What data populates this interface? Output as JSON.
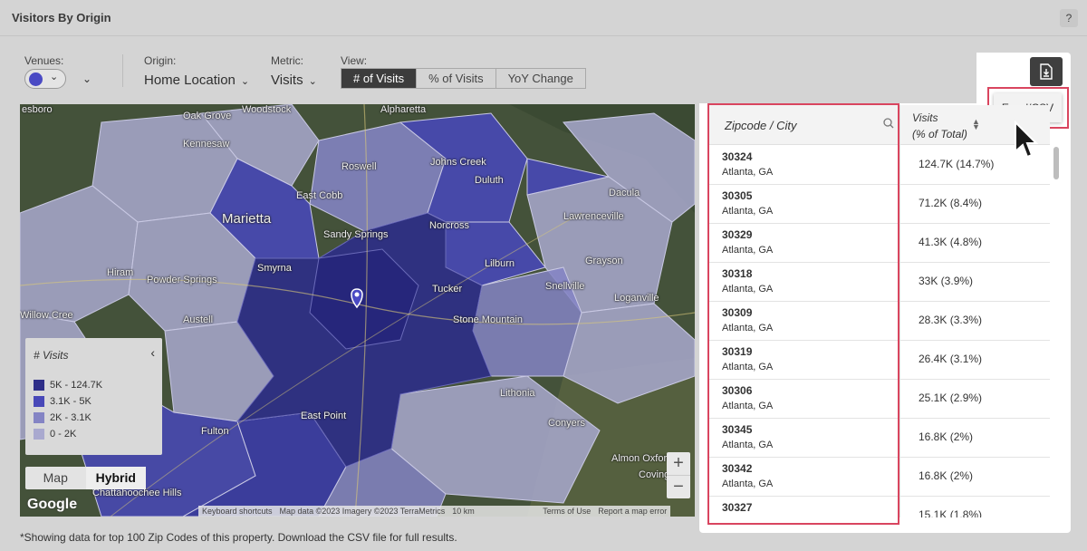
{
  "header": {
    "title": "Visitors By Origin",
    "help": "?"
  },
  "controls": {
    "venues_label": "Venues:",
    "origin_label": "Origin:",
    "origin_value": "Home Location",
    "metric_label": "Metric:",
    "metric_value": "Visits",
    "view_label": "View:",
    "view_options": [
      "# of Visits",
      "% of Visits",
      "YoY Change"
    ],
    "view_selected": "# of Visits",
    "venue_color": "#4a4ac4"
  },
  "map": {
    "labels": [
      "esboro",
      "Oak Grove",
      "Woodstock",
      "Alpharetta",
      "Kennesaw",
      "Roswell",
      "Johns Creek",
      "Duluth",
      "East Cobb",
      "Marietta",
      "Sandy Springs",
      "Norcross",
      "Dacula",
      "Lawrenceville",
      "Hiram",
      "Powder Springs",
      "Smyrna",
      "Grayson",
      "Snellville",
      "Tucker",
      "Lilburn",
      "Loganville",
      "Willow Cree",
      "Austell",
      "Stone Mountain",
      "Fulton",
      "East Point",
      "Lithonia",
      "Conyers",
      "Chattahoochee Hills",
      "Almon Oxford",
      "Covington"
    ],
    "legend": {
      "title": "# Visits",
      "items": [
        {
          "label": "5K - 124.7K",
          "color": "#2e2e88"
        },
        {
          "label": "3.1K - 5K",
          "color": "#4848b8"
        },
        {
          "label": "2K - 3.1K",
          "color": "#8484c4"
        },
        {
          "label": "0 - 2K",
          "color": "#a9a9cf"
        }
      ]
    },
    "map_types": [
      "Map",
      "Hybrid"
    ],
    "map_type_selected": "Hybrid",
    "zoom_in": "+",
    "zoom_out": "−",
    "google": "Google",
    "attribution": [
      "Keyboard shortcuts",
      "Map data ©2023 Imagery ©2023 TerraMetrics",
      "10 km",
      "Terms of Use",
      "Report a map error"
    ]
  },
  "export": {
    "option": "Excel/CSV",
    "icon": "download-file-icon"
  },
  "table": {
    "col1": "Zipcode / City",
    "col2_line1": "Visits",
    "col2_line2": "(% of Total)",
    "rows": [
      {
        "zip": "30324",
        "city": "Atlanta, GA",
        "visits": "124.7K (14.7%)"
      },
      {
        "zip": "30305",
        "city": "Atlanta, GA",
        "visits": "71.2K (8.4%)"
      },
      {
        "zip": "30329",
        "city": "Atlanta, GA",
        "visits": "41.3K (4.8%)"
      },
      {
        "zip": "30318",
        "city": "Atlanta, GA",
        "visits": "33K (3.9%)"
      },
      {
        "zip": "30309",
        "city": "Atlanta, GA",
        "visits": "28.3K (3.3%)"
      },
      {
        "zip": "30319",
        "city": "Atlanta, GA",
        "visits": "26.4K (3.1%)"
      },
      {
        "zip": "30306",
        "city": "Atlanta, GA",
        "visits": "25.1K (2.9%)"
      },
      {
        "zip": "30345",
        "city": "Atlanta, GA",
        "visits": "16.8K (2%)"
      },
      {
        "zip": "30342",
        "city": "Atlanta, GA",
        "visits": "16.8K (2%)"
      },
      {
        "zip": "30327",
        "city": "",
        "visits": "15.1K (1.8%)"
      }
    ]
  },
  "footnote": "*Showing data for top 100 Zip Codes of this property. Download the CSV file for full results."
}
